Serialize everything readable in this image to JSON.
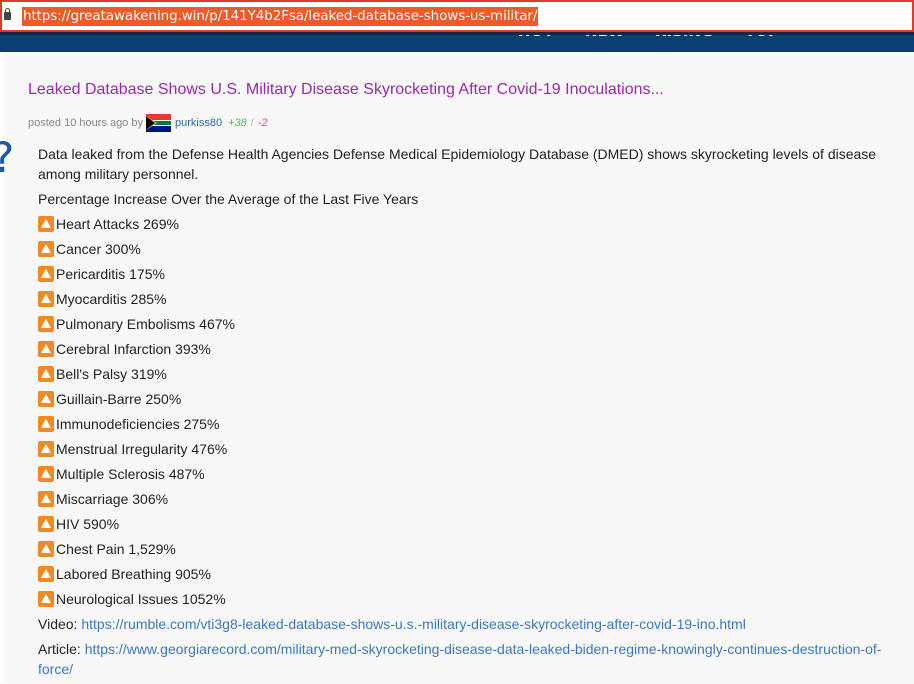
{
  "browser": {
    "url": "https://greatawakening.win/p/141Y4b2Fsa/leaked-database-shows-us-militar/"
  },
  "nav": {
    "items": [
      "HOT",
      "NEW",
      "RISING",
      "TOP"
    ]
  },
  "post": {
    "title": "Leaked Database Shows U.S. Military Disease Skyrocketing After Covid-19 Inoculations...",
    "meta_prefix": "posted 10 hours ago by",
    "author": "purkiss80",
    "upvotes": "+38",
    "separator": "/",
    "downvotes": "-2",
    "intro": "Data leaked from the Defense Health Agencies Defense Medical Epidemiology Database (DMED) shows skyrocketing levels of disease among military personnel.",
    "subheading": "Percentage Increase Over the Average of the Last Five Years",
    "items": [
      "Heart Attacks 269%",
      "Cancer 300%",
      "Pericarditis 175%",
      "Myocarditis 285%",
      "Pulmonary Embolisms 467%",
      "Cerebral Infarction 393%",
      "Bell's Palsy 319%",
      "Guillain-Barre 250%",
      "Immunodeficiencies 275%",
      "Menstrual Irregularity 476%",
      "Multiple Sclerosis 487%",
      "Miscarriage 306%",
      "HIV 590%",
      "Chest Pain 1,529%",
      "Labored Breathing 905%",
      "Neurological Issues 1052%"
    ],
    "item_icon": "up-button-icon",
    "video_label": "Video:",
    "video_url": "https://rumble.com/vti3g8-leaked-database-shows-u.s.-military-disease-skyrocketing-after-covid-19-ino.html",
    "article_label": "Article:",
    "article_url": "https://www.georgiarecord.com/military-med-skyrocketing-disease-data-leaked-biden-regime-knowingly-continues-destruction-of-force/"
  },
  "colors": {
    "title": "#9b27af",
    "link": "#3b78c4",
    "nav_bg": "#0b3e73",
    "icon": "#f08a24"
  }
}
